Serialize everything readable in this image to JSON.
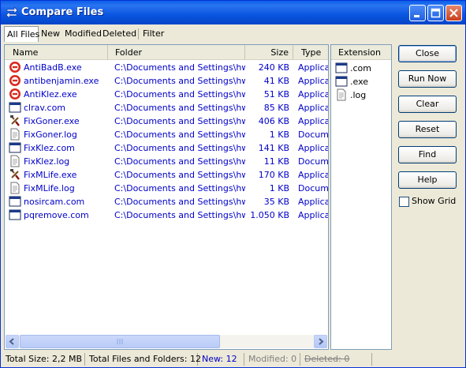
{
  "window": {
    "title": "Compare Files"
  },
  "tabs": [
    "All Files",
    "New",
    "Modified",
    "Deleted",
    "Filter"
  ],
  "table": {
    "columns": {
      "name": "Name",
      "folder": "Folder",
      "size": "Size",
      "type": "Type"
    },
    "rows": [
      {
        "icon": "antivirus-app-icon",
        "name": "AntiBadB.exe",
        "folder": "C:\\Documents and Settings\\hwf...",
        "size": "240 KB",
        "type": "Applicaz"
      },
      {
        "icon": "antivirus-app-icon",
        "name": "antibenjamin.exe",
        "folder": "C:\\Documents and Settings\\hwf...",
        "size": "41 KB",
        "type": "Applicaz"
      },
      {
        "icon": "antivirus-app-icon",
        "name": "AntiKlez.exe",
        "folder": "C:\\Documents and Settings\\hwf...",
        "size": "51 KB",
        "type": "Applicaz"
      },
      {
        "icon": "window-app-icon",
        "name": "clrav.com",
        "folder": "C:\\Documents and Settings\\hwf...",
        "size": "85 KB",
        "type": "Applicaz"
      },
      {
        "icon": "tool-app-icon",
        "name": "FixGoner.exe",
        "folder": "C:\\Documents and Settings\\hwf...",
        "size": "406 KB",
        "type": "Applicaz"
      },
      {
        "icon": "text-document-icon",
        "name": "FixGoner.log",
        "folder": "C:\\Documents and Settings\\hwf...",
        "size": "1 KB",
        "type": "Docume"
      },
      {
        "icon": "window-app-icon",
        "name": "FixKlez.com",
        "folder": "C:\\Documents and Settings\\hwf...",
        "size": "141 KB",
        "type": "Applicaz"
      },
      {
        "icon": "text-document-icon",
        "name": "FixKlez.log",
        "folder": "C:\\Documents and Settings\\hwf...",
        "size": "11 KB",
        "type": "Docume"
      },
      {
        "icon": "tool-app-icon",
        "name": "FixMLife.exe",
        "folder": "C:\\Documents and Settings\\hwf...",
        "size": "170 KB",
        "type": "Applicaz"
      },
      {
        "icon": "text-document-icon",
        "name": "FixMLife.log",
        "folder": "C:\\Documents and Settings\\hwf...",
        "size": "1 KB",
        "type": "Docume"
      },
      {
        "icon": "window-app-icon",
        "name": "nosircam.com",
        "folder": "C:\\Documents and Settings\\hwf...",
        "size": "35 KB",
        "type": "Applicaz"
      },
      {
        "icon": "window-app-icon",
        "name": "pqremove.com",
        "folder": "C:\\Documents and Settings\\hwf...",
        "size": "1.050 KB",
        "type": "Applicaz"
      }
    ]
  },
  "extensions": {
    "header": "Extension",
    "items": [
      {
        "icon": "window-app-icon",
        "label": ".com"
      },
      {
        "icon": "window-app-icon",
        "label": ".exe"
      },
      {
        "icon": "text-document-icon",
        "label": ".log"
      }
    ]
  },
  "buttons": [
    "Close",
    "Run Now",
    "Clear",
    "Reset",
    "Find",
    "Help"
  ],
  "show_grid": {
    "label": "Show Grid",
    "checked": false
  },
  "status": {
    "total_size": "Total Size: 2,2 MB",
    "total_files": "Total Files and Folders: 12",
    "new": "New: 12",
    "modified": "Modified: 0",
    "deleted": "Deleted: 0"
  },
  "colors": {
    "link_blue": "#0000c8",
    "new_blue": "#0000c8",
    "disabled_gray": "#808080",
    "titlebar": "#0a55e0"
  }
}
